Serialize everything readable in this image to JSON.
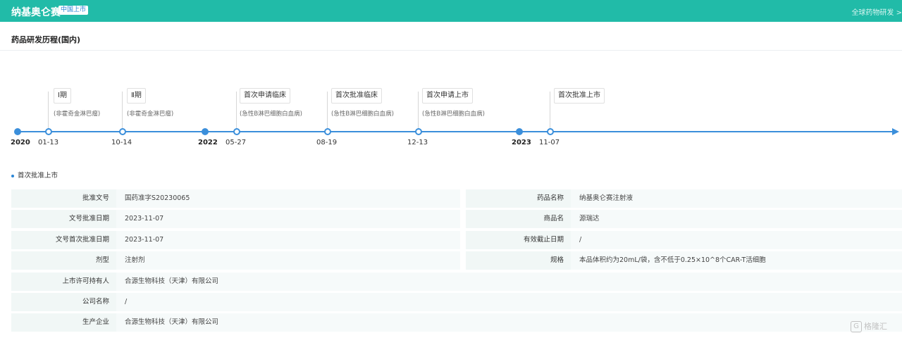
{
  "header": {
    "title": "纳基奥仑赛",
    "badge": "中国上市",
    "global_link": "全球药物研发 >"
  },
  "section": {
    "title": "药品研发历程(国内)"
  },
  "timeline": {
    "ticks": [
      {
        "label": "2020",
        "bold": true
      },
      {
        "label": "01-13"
      },
      {
        "label": "10-14"
      },
      {
        "label": "2022",
        "bold": true
      },
      {
        "label": "05-27"
      },
      {
        "label": "08-19"
      },
      {
        "label": "12-13"
      },
      {
        "label": "2023",
        "bold": true
      },
      {
        "label": "11-07"
      }
    ],
    "events": [
      {
        "label": "Ⅰ期",
        "sub": "(非霍奇金淋巴瘤)"
      },
      {
        "label": "Ⅱ期",
        "sub": "(非霍奇金淋巴瘤)"
      },
      {
        "label": "首次申请临床",
        "sub": "(急性B淋巴细胞白血病)"
      },
      {
        "label": "首次批准临床",
        "sub": "(急性B淋巴细胞白血病)"
      },
      {
        "label": "首次申请上市",
        "sub": "(急性B淋巴细胞白血病)"
      },
      {
        "label": "首次批准上市",
        "sub": ""
      }
    ]
  },
  "detail": {
    "heading": "首次批准上市",
    "rows_left": [
      {
        "label": "批准文号",
        "value": "国药准字S20230065"
      },
      {
        "label": "文号批准日期",
        "value": "2023-11-07"
      },
      {
        "label": "文号首次批准日期",
        "value": "2023-11-07"
      },
      {
        "label": "剂型",
        "value": "注射剂"
      }
    ],
    "rows_right": [
      {
        "label": "药品名称",
        "value": "纳基奥仑赛注射液"
      },
      {
        "label": "商品名",
        "value": "源瑞达"
      },
      {
        "label": "有效截止日期",
        "value": "/"
      },
      {
        "label": "规格",
        "value": "本品体积约为20mL/袋，含不低于0.25×10^8个CAR-T活细胞"
      }
    ],
    "rows_full": [
      {
        "label": "上市许可持有人",
        "value": "合源生物科技（天津）有限公司"
      },
      {
        "label": "公司名称",
        "value": "/"
      },
      {
        "label": "生产企业",
        "value": "合源生物科技（天津）有限公司"
      }
    ]
  },
  "watermark": {
    "glyph": "G",
    "text": "格隆汇"
  }
}
